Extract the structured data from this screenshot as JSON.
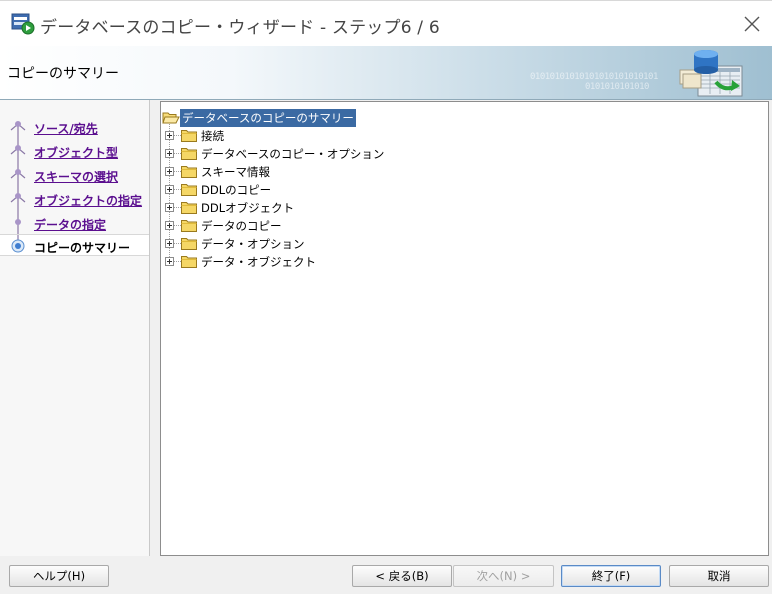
{
  "window": {
    "title": "データベースのコピー・ウィザード - ステップ6 / 6",
    "close_icon": "close-icon"
  },
  "banner": {
    "heading": "コピーのサマリー",
    "decoration_text_1": "01010101010101010101010101",
    "decoration_text_2": "0101010101010"
  },
  "steps": [
    {
      "label": "ソース/宛先",
      "state": "done"
    },
    {
      "label": "オブジェクト型",
      "state": "done"
    },
    {
      "label": "スキーマの選択",
      "state": "done"
    },
    {
      "label": "オブジェクトの指定",
      "state": "done"
    },
    {
      "label": "データの指定",
      "state": "done"
    },
    {
      "label": "コピーのサマリー",
      "state": "current"
    }
  ],
  "tree": {
    "root_label": "データベースのコピーのサマリー",
    "items": [
      {
        "label": "接続"
      },
      {
        "label": "データベースのコピー・オプション"
      },
      {
        "label": "スキーマ情報"
      },
      {
        "label": "DDLのコピー"
      },
      {
        "label": "DDLオブジェクト"
      },
      {
        "label": "データのコピー"
      },
      {
        "label": "データ・オプション"
      },
      {
        "label": "データ・オブジェクト"
      }
    ]
  },
  "buttons": {
    "help": "ヘルプ(H)",
    "back": "< 戻る(B)",
    "next": "次へ(N) >",
    "finish": "終了(F)",
    "cancel": "取消"
  },
  "colors": {
    "accent": "#3b6aa3",
    "link": "#5b0f8f"
  }
}
